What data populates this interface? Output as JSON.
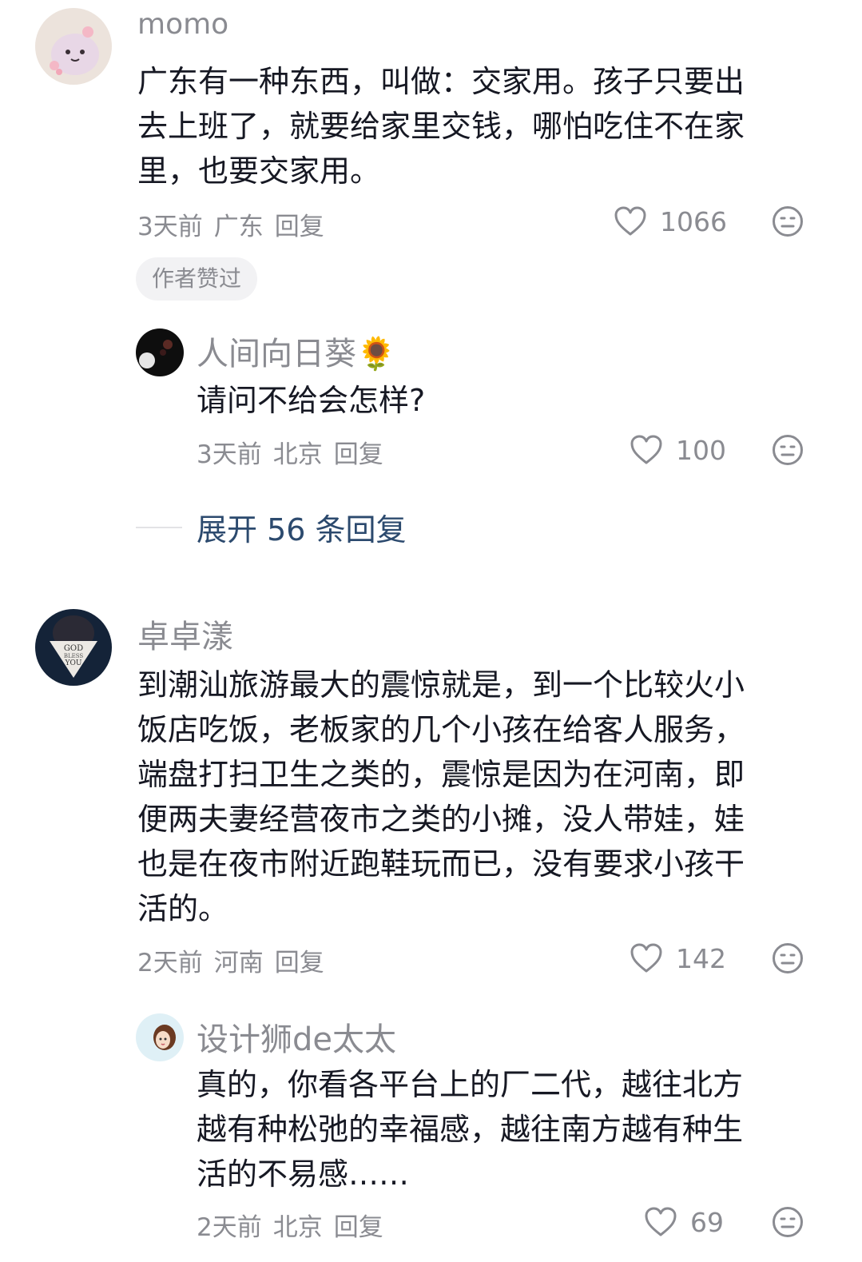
{
  "comments": [
    {
      "username": "momo",
      "text": "广东有一种东西，叫做：交家用。孩子只要出\n去上班了，就要给家里交钱，哪怕吃住不在家\n里，也要交家用。",
      "time": "3天前",
      "location": "广东",
      "reply_label": "回复",
      "likes": "1066",
      "badge": "作者赞过",
      "replies": [
        {
          "username": "人间向日葵🌻",
          "text": "请问不给会怎样?",
          "time": "3天前",
          "location": "北京",
          "reply_label": "回复",
          "likes": "100"
        }
      ],
      "expand_label": "展开 56 条回复"
    },
    {
      "username": "卓卓漾",
      "avatar_text": "GOD BLESS YOU",
      "text": "到潮汕旅游最大的震惊就是，到一个比较火小\n饭店吃饭，老板家的几个小孩在给客人服务，\n端盘打扫卫生之类的，震惊是因为在河南，即\n便两夫妻经营夜市之类的小摊，没人带娃，娃\n也是在夜市附近跑鞋玩而已，没有要求小孩干\n活的。",
      "time": "2天前",
      "location": "河南",
      "reply_label": "回复",
      "likes": "142",
      "replies": [
        {
          "username": "设计狮de太太",
          "text": "真的，你看各平台上的厂二代，越往北方\n越有种松弛的幸福感，越往南方越有种生\n活的不易感……",
          "time": "2天前",
          "location": "北京",
          "reply_label": "回复",
          "likes": "69"
        }
      ]
    }
  ],
  "colors": {
    "text_primary": "#161823",
    "text_secondary": "#8a8b91",
    "link": "#2c4a6e",
    "badge_bg": "#f2f2f4"
  },
  "icons": {
    "like": "heart-outline-icon",
    "dislike": "meh-face-icon"
  }
}
